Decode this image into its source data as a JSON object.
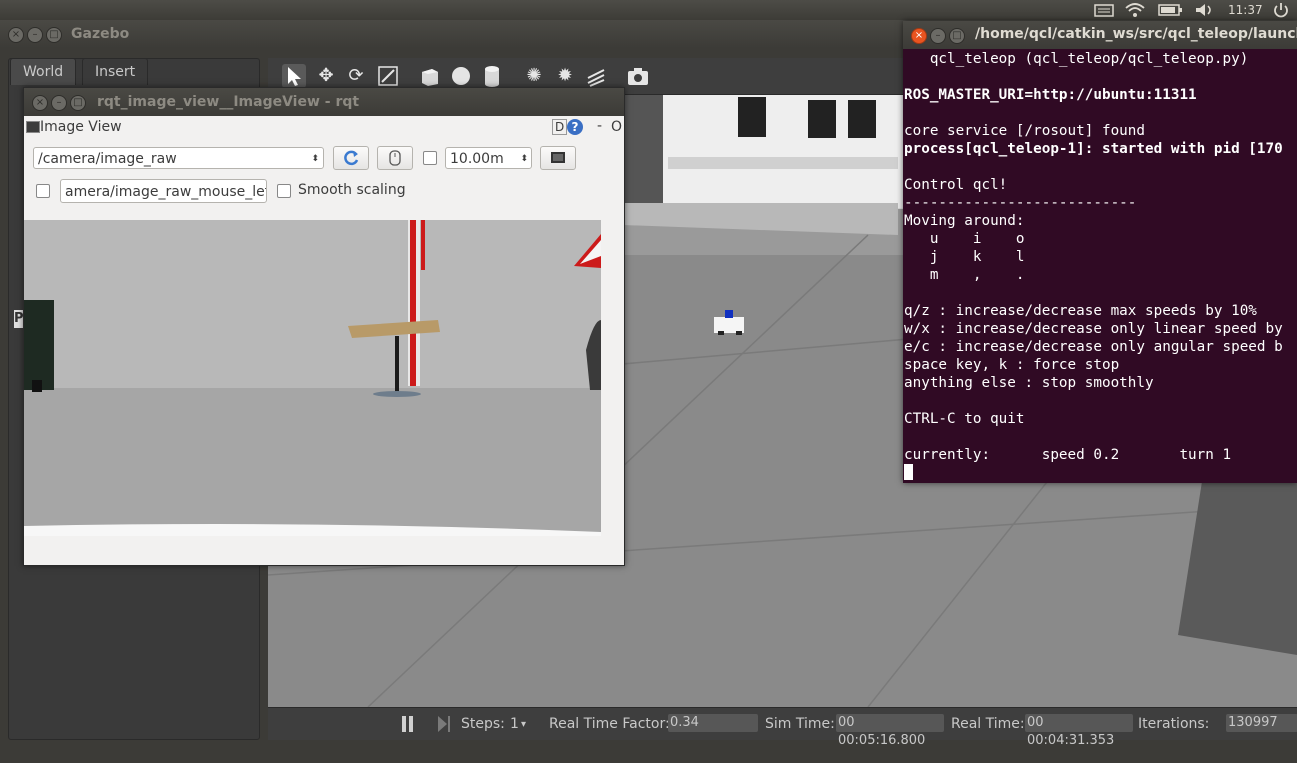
{
  "top_panel": {
    "clock": "11:37",
    "icons": [
      "keyboard-icon",
      "wifi-icon",
      "battery-icon",
      "volume-icon",
      "power-icon"
    ]
  },
  "gazebo": {
    "title": "Gazebo",
    "tabs": [
      {
        "label": "World"
      },
      {
        "label": "Insert"
      }
    ],
    "toolbar_icons": [
      "select-arrow-icon",
      "translate-icon",
      "rotate-icon",
      "scale-icon",
      "box-icon",
      "sphere-icon",
      "cylinder-icon",
      "point-light-icon",
      "spot-light-icon",
      "directional-light-icon",
      "screenshot-icon"
    ],
    "status": {
      "steps_label": "Steps:",
      "steps_value": "1",
      "rtf_label": "Real Time Factor:",
      "rtf_value": "0.34",
      "sim_time_label": "Sim Time:",
      "sim_time_value": "00 00:05:16.800",
      "real_time_label": "Real Time:",
      "real_time_value": "00 00:04:31.353",
      "iterations_label": "Iterations:",
      "iterations_value": "130997"
    },
    "side_letter": "P"
  },
  "rqt": {
    "title": "rqt_image_view__ImageView - rqt",
    "plugin_title": "Image View",
    "plugin_buttons": {
      "d": "D",
      "help": "?",
      "minimize": "-",
      "close": "O"
    },
    "topic": "/camera/image_raw",
    "mouse_topic": "amera/image_raw_mouse_left",
    "smooth_scaling": "Smooth scaling",
    "zoom": "10.00m"
  },
  "terminal": {
    "title": "/home/qcl/catkin_ws/src/qcl_teleop/launch/qc",
    "lines": [
      "   qcl_teleop (qcl_teleop/qcl_teleop.py)",
      "",
      "ROS_MASTER_URI=http://ubuntu:11311",
      "",
      "core service [/rosout] found",
      "process[qcl_teleop-1]: started with pid [170",
      "",
      "Control qcl!",
      "---------------------------",
      "Moving around:",
      "   u    i    o",
      "   j    k    l",
      "   m    ,    .",
      "",
      "q/z : increase/decrease max speeds by 10%",
      "w/x : increase/decrease only linear speed by",
      "e/c : increase/decrease only angular speed b",
      "space key, k : force stop",
      "anything else : stop smoothly",
      "",
      "CTRL-C to quit",
      "",
      "currently:      speed 0.2       turn 1"
    ],
    "bold_lines": [
      2,
      5
    ]
  }
}
